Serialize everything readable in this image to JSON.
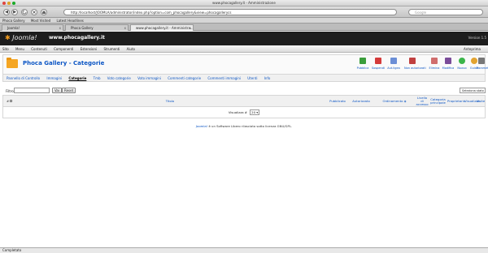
{
  "browser": {
    "window_title": "www.phocagallery.it - Amministrazione",
    "url": "http://localhost/JOOMLA/administrator/index.php?option=com_phocagallery&view=phocagallerycs",
    "search_placeholder": "Google",
    "back_glyph": "◀",
    "forward_glyph": "▶",
    "bookmarks": [
      "Phoca Gallery",
      "Most Visited",
      "Latest Headlines"
    ],
    "tabs": [
      {
        "label": "Joomla!",
        "close": "x"
      },
      {
        "label": "Phoca Gallery",
        "close": "x"
      },
      {
        "label": "www.phocagallery.it - Amministra...",
        "close": "x"
      }
    ]
  },
  "joomla": {
    "logo_text": "Joomla!",
    "site_name": "www.phocagallery.it",
    "version": "Version 1.5",
    "menu": [
      "Sito",
      "Menu",
      "Contenuti",
      "Componenti",
      "Estensioni",
      "Strumenti",
      "Aiuto"
    ],
    "menu_right": "Anteprima"
  },
  "page": {
    "title": "Phoca Gallery - Categorie",
    "toolbar": [
      {
        "label": "Pubblica",
        "color": "#3a9d3a"
      },
      {
        "label": "Sospendi",
        "color": "#d43a3a"
      },
      {
        "label": "Aut.ligea",
        "color": "#6b8ed6"
      },
      {
        "label": "Non autorizzati",
        "color": "#c04040"
      },
      {
        "label": "Elimina",
        "color": "#d06d6d"
      },
      {
        "label": "Modifica",
        "color": "#7a4b99"
      },
      {
        "label": "Nuovo",
        "color": "#3bb54a"
      },
      {
        "label": "Guida",
        "color": "#e2a330"
      },
      {
        "label": "Parametri",
        "color": "#777777"
      }
    ],
    "submenu": [
      {
        "label": "Pannello di Controllo",
        "active": false
      },
      {
        "label": "Immagini",
        "active": false
      },
      {
        "label": "Categorie",
        "active": true
      },
      {
        "label": "Tmb",
        "active": false
      },
      {
        "label": "Voto categorie",
        "active": false
      },
      {
        "label": "Voto immagini",
        "active": false
      },
      {
        "label": "Commenti categorie",
        "active": false
      },
      {
        "label": "Commenti immagini",
        "active": false
      },
      {
        "label": "Utenti",
        "active": false
      },
      {
        "label": "Info",
        "active": false
      }
    ],
    "filter": {
      "label": "Filtro",
      "value": "",
      "go_label": "Vai",
      "reset_label": "Reset",
      "select_label": "Seleziona stato"
    },
    "table": {
      "headers": {
        "num": "#",
        "title": "Titolo",
        "published": "Pubblicato",
        "authorized": "Autorizzato",
        "order": "Ordinamento",
        "order_icon": "◈",
        "access": "Livello di accesso",
        "parent": "Categoria principale",
        "owner": "Proprietario",
        "votes": "Visualizza",
        "views": "Visite"
      },
      "pager_label": "Visualizza #",
      "pager_value": "20"
    }
  },
  "footer": {
    "link": "Joomla!",
    "text": "è un Software Libero rilasciato sotto licenza GNU/GPL."
  },
  "status": {
    "text": "Completato"
  }
}
